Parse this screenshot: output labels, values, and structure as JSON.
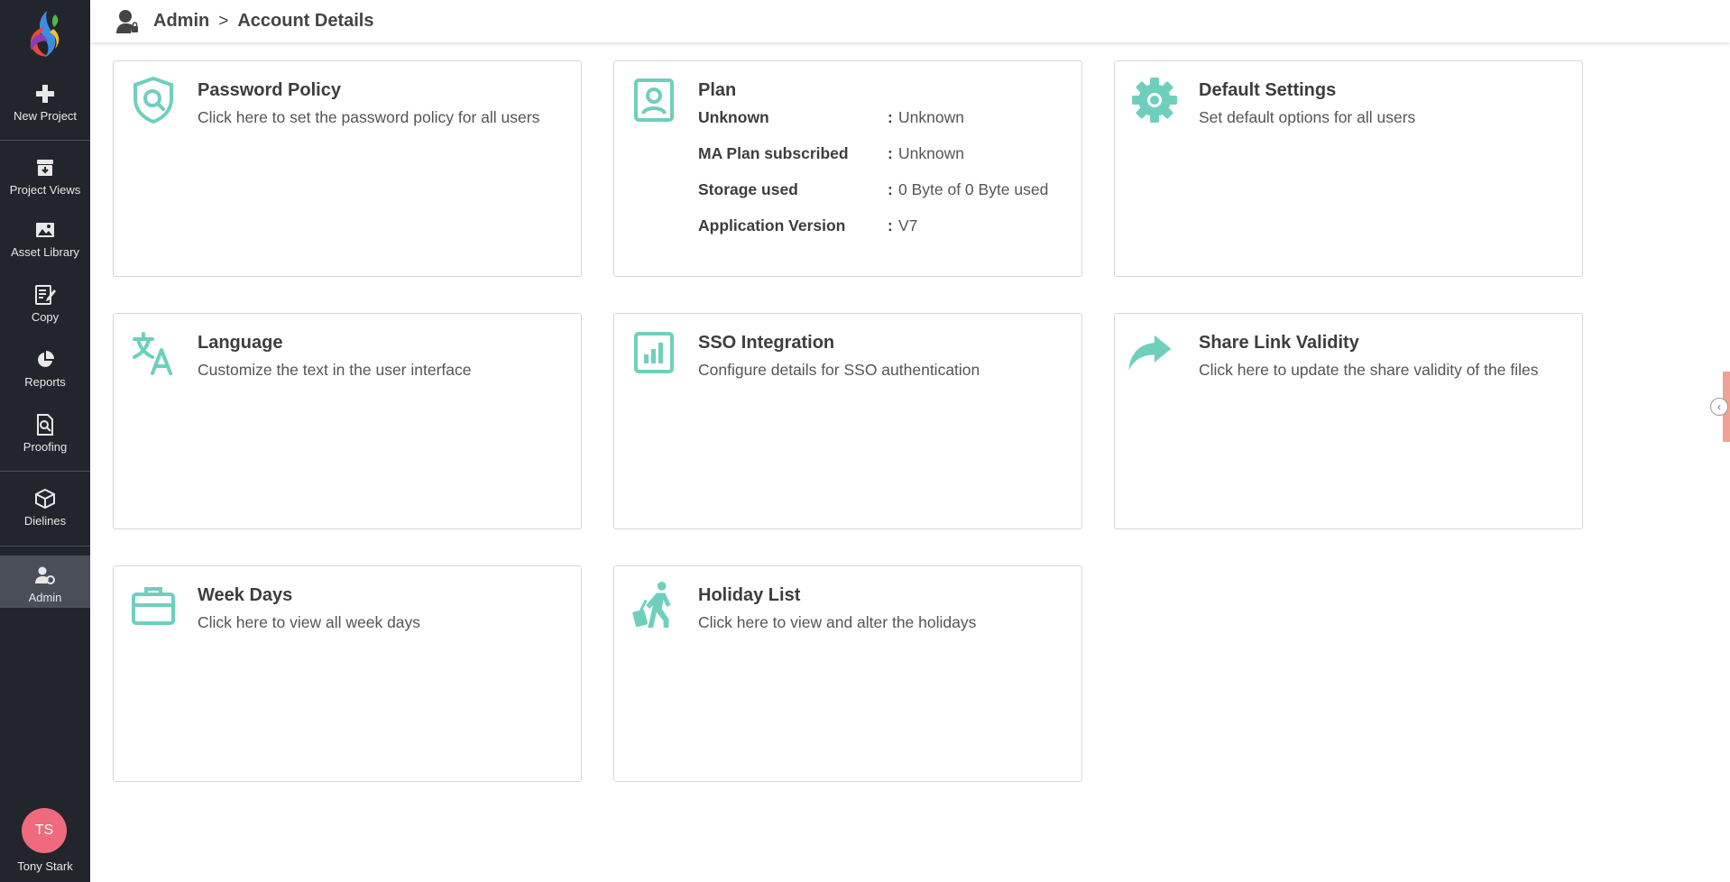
{
  "colors": {
    "sidebar_bg": "#22252b",
    "accent": "#6fcfbd",
    "avatar": "#ef6a7d"
  },
  "sidebar": {
    "logo_icon": "brand-logo",
    "items": [
      {
        "label": "New Project",
        "icon": "plus-icon"
      },
      {
        "label": "Project Views",
        "icon": "archive-icon"
      },
      {
        "label": "Asset Library",
        "icon": "image-icon"
      },
      {
        "label": "Copy",
        "icon": "edit-document-icon"
      },
      {
        "label": "Reports",
        "icon": "pie-chart-icon"
      },
      {
        "label": "Proofing",
        "icon": "proofing-icon"
      },
      {
        "label": "Dielines",
        "icon": "box-icon"
      },
      {
        "label": "Admin",
        "icon": "admin-user-icon",
        "active": true
      }
    ],
    "user": {
      "initials": "TS",
      "name": "Tony Stark"
    }
  },
  "header": {
    "icon": "admin-user-icon",
    "breadcrumb": [
      "Admin",
      ">",
      "Account Details"
    ]
  },
  "cards": [
    {
      "title": "Password Policy",
      "description": "Click here to set the password policy for all users",
      "icon": "shield-search-icon"
    },
    {
      "title": "Plan",
      "icon": "id-badge-icon",
      "rows": [
        {
          "key": "Unknown",
          "value": "Unknown"
        },
        {
          "key": "MA Plan subscribed",
          "value": "Unknown"
        },
        {
          "key": "Storage used",
          "value": "0 Byte of 0 Byte used"
        },
        {
          "key": "Application Version",
          "value": "V7"
        }
      ],
      "colon": ":"
    },
    {
      "title": "Default Settings",
      "description": "Set default options for all users",
      "icon": "gear-icon"
    },
    {
      "title": "Language",
      "description": "Customize the text in the user interface",
      "icon": "translate-icon"
    },
    {
      "title": "SSO Integration",
      "description": "Configure details for SSO authentication",
      "icon": "chart-box-icon"
    },
    {
      "title": "Share Link Validity",
      "description": "Click here to update the share validity of the files",
      "icon": "share-arrow-icon"
    },
    {
      "title": "Week Days",
      "description": "Click here to view all week days",
      "icon": "briefcase-icon"
    },
    {
      "title": "Holiday List",
      "description": "Click here to view and alter the holidays",
      "icon": "traveler-icon"
    }
  ],
  "side_panel": {
    "toggle_icon": "chevron-left-icon",
    "toggle_glyph": "‹"
  }
}
